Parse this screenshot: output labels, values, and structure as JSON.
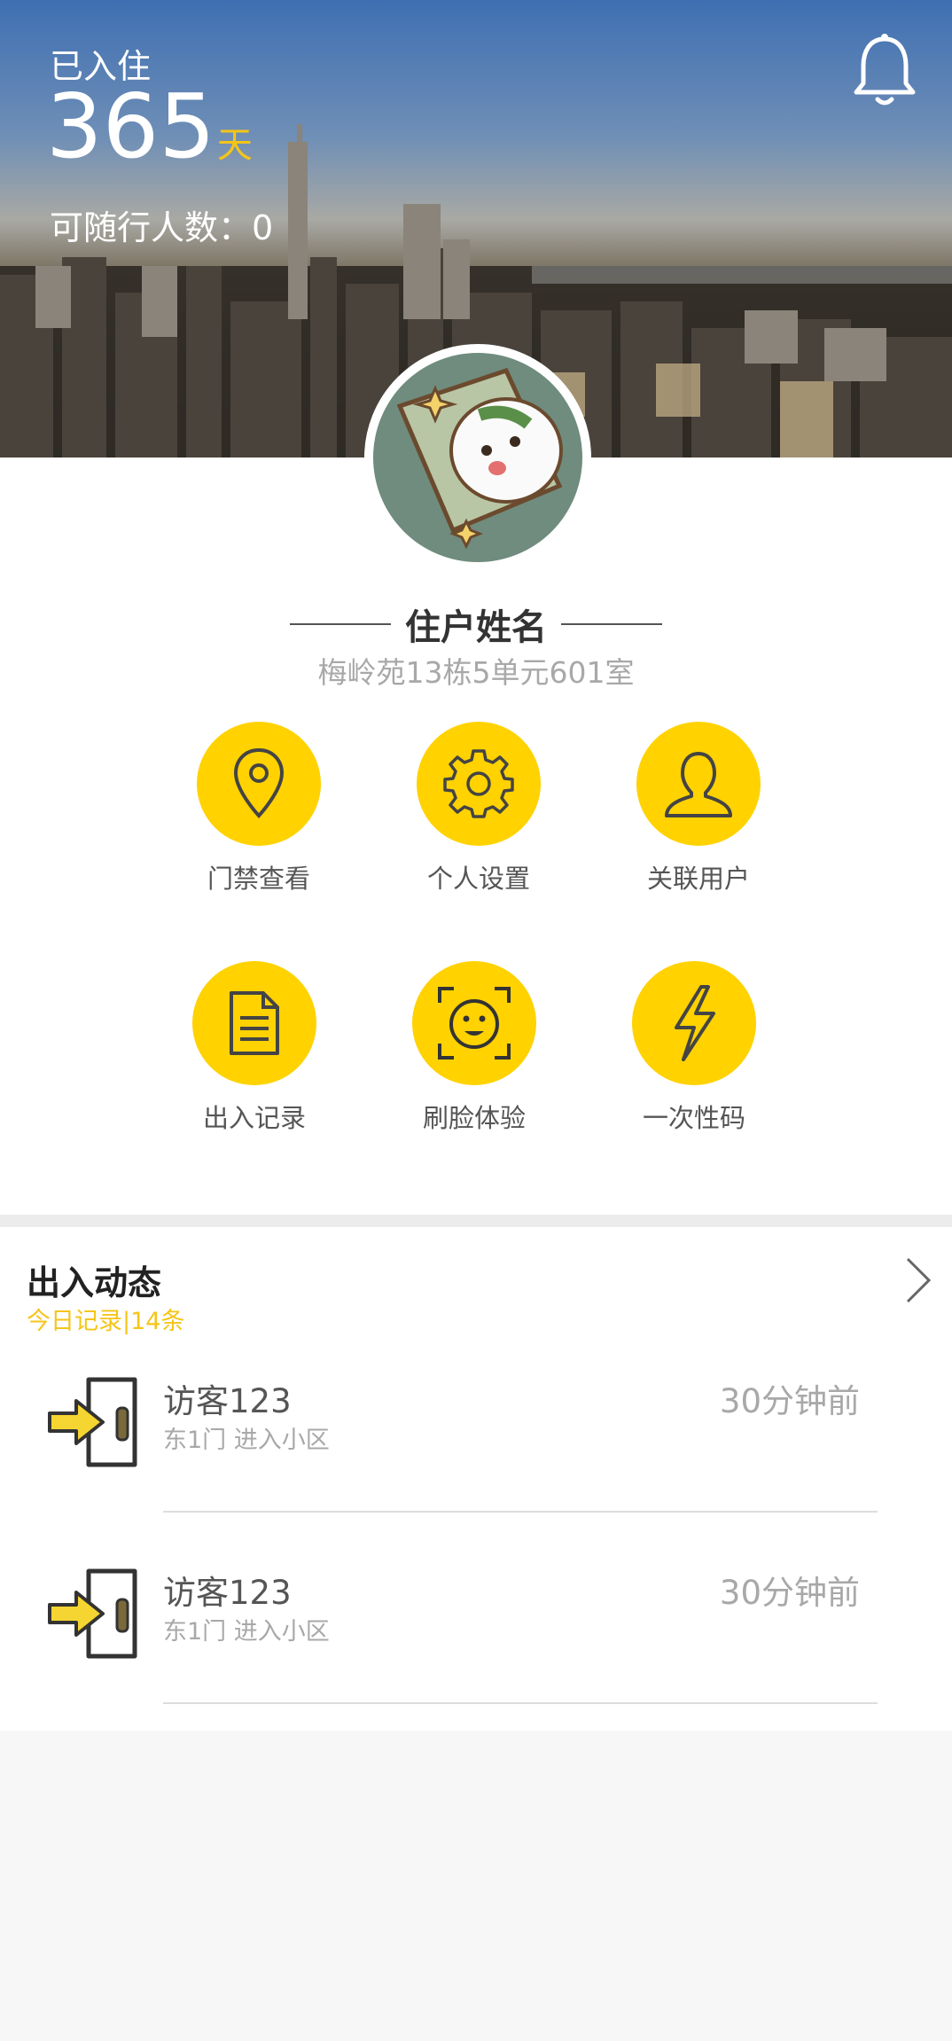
{
  "header": {
    "stay_label": "已入住",
    "days": "365",
    "days_unit": "天",
    "companions_label": "可随行人数：",
    "companions_count": "0",
    "bell_icon": "bell-icon"
  },
  "profile": {
    "avatar_icon": "avatar-cartoon",
    "name": "住户姓名",
    "address": "梅岭苑13栋5单元601室"
  },
  "actions": [
    {
      "label": "门禁查看",
      "icon": "location-pin-icon"
    },
    {
      "label": "个人设置",
      "icon": "gear-icon"
    },
    {
      "label": "关联用户",
      "icon": "user-icon"
    },
    {
      "label": "出入记录",
      "icon": "document-icon"
    },
    {
      "label": "刷脸体验",
      "icon": "face-scan-icon"
    },
    {
      "label": "一次性码",
      "icon": "lightning-icon"
    }
  ],
  "activity": {
    "title": "出入动态",
    "subtitle": "今日记录|14条",
    "records": [
      {
        "name": "访客123",
        "location": "东1门 进入小区",
        "time": "30分钟前"
      },
      {
        "name": "访客123",
        "location": "东1门 进入小区",
        "time": "30分钟前"
      }
    ]
  },
  "colors": {
    "accent": "#ffd200",
    "accent_text": "#f5c518"
  }
}
